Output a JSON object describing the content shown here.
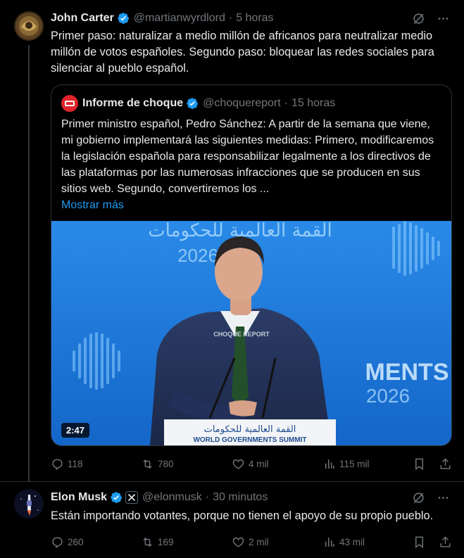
{
  "post1": {
    "author_name": "John Carter",
    "handle": "@martianwyrdlord",
    "separator": "·",
    "time": "5 horas",
    "text": "Primer paso: naturalizar a medio millón de africanos para neutralizar medio millón de votos españoles. Segundo paso: bloquear las redes sociales para silenciar al pueblo español.",
    "quote": {
      "author_name": "Informe de choque",
      "handle": "@choquereport",
      "separator": "·",
      "time": "15 horas",
      "text": "Primer ministro español, Pedro Sánchez: A partir de la semana que viene, mi gobierno implementará las siguientes medidas: Primero, modificaremos la legislación española para responsabilizar legalmente a los directivos de las plataformas por las numerosas infracciones que se producen en sus sitios web. Segundo, convertiremos los ...",
      "show_more": "Mostrar más",
      "media": {
        "duration": "2:47",
        "backdrop_arabic": "القمة العالمية للحكومات",
        "backdrop_year": "2026",
        "backdrop_ments": "MENTS",
        "backdrop_year2": "2026",
        "podium_arabic": "القمة العالمية للحكومات",
        "podium_english": "WORLD GOVERNMENTS SUMMIT",
        "watermark": "CHOQUE REPORT"
      }
    },
    "actions": {
      "replies": "118",
      "reposts": "780",
      "likes": "4 mil",
      "views": "115 mil"
    }
  },
  "post2": {
    "author_name": "Elon Musk",
    "handle": "@elonmusk",
    "separator": "·",
    "time": "30 minutos",
    "text": "Están importando votantes, porque no tienen el apoyo de su propio pueblo.",
    "actions": {
      "replies": "260",
      "reposts": "169",
      "likes": "2 mil",
      "views": "43 mil"
    }
  },
  "colors": {
    "background": "#000000",
    "text": "#e7e9ea",
    "muted": "#71767b",
    "accent": "#1d9bf0",
    "border": "#2f3336"
  },
  "icons": [
    "verified-badge-icon",
    "grok-icon",
    "more-icon",
    "reply-icon",
    "repost-icon",
    "like-icon",
    "views-icon",
    "bookmark-icon",
    "share-icon",
    "x-affiliate-icon"
  ]
}
